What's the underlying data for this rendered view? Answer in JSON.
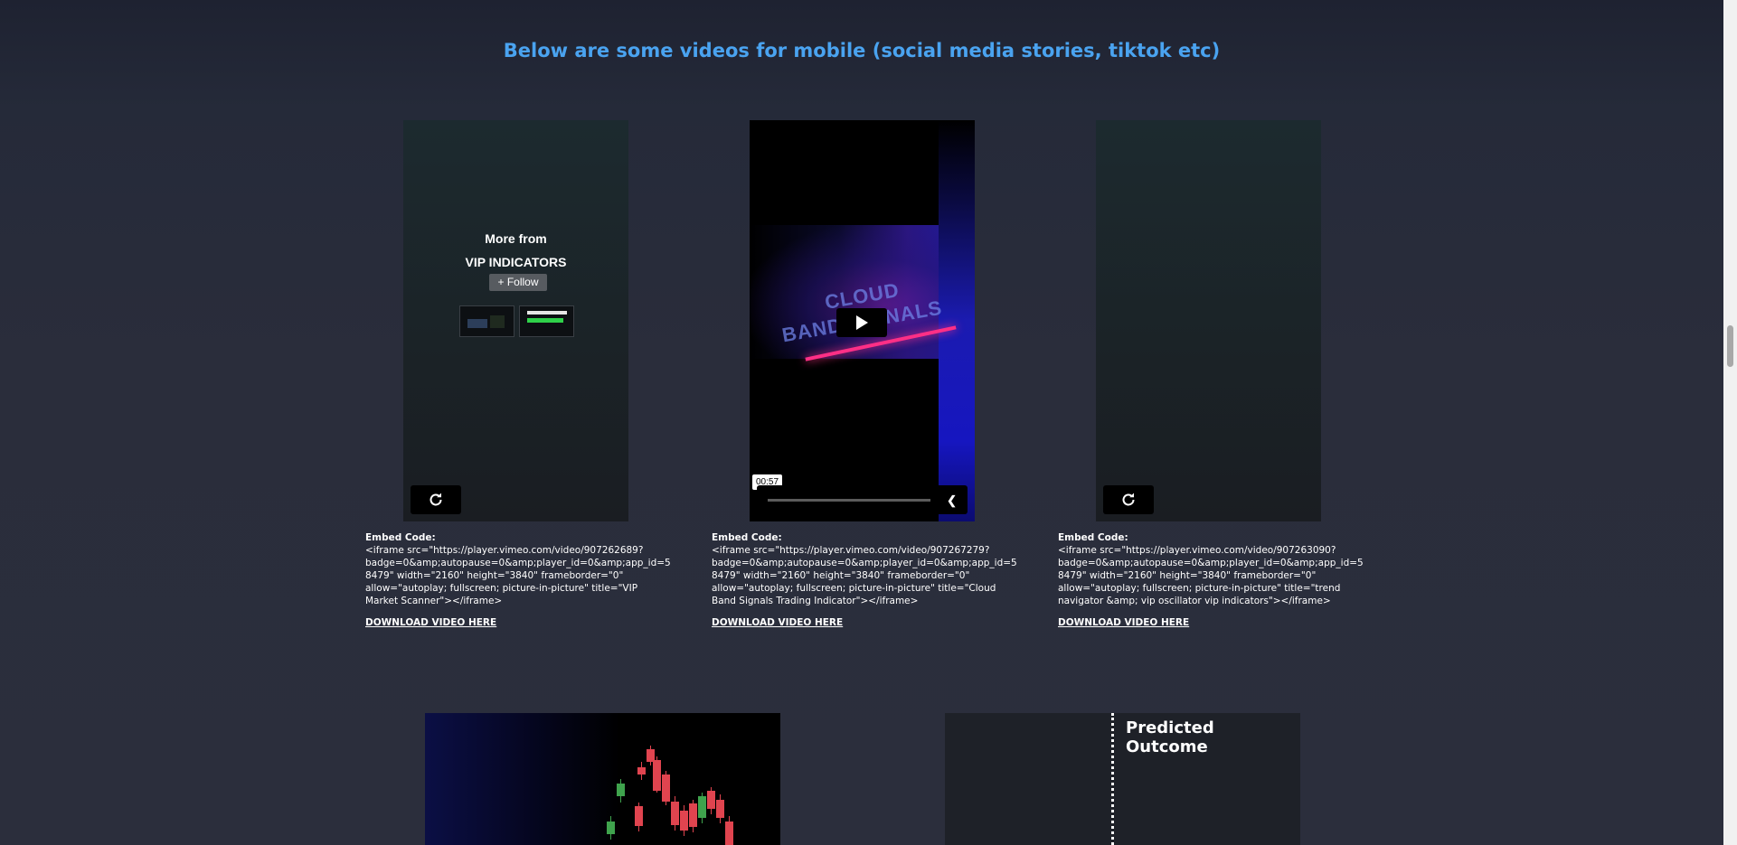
{
  "heading": "Below are some videos for mobile (social media stories, tiktok etc)",
  "videos": [
    {
      "end_screen": {
        "more_from": "More from",
        "channel": "VIP INDICATORS",
        "follow_label": "+ Follow"
      },
      "embed_label": "Embed Code:",
      "embed_code": "<iframe  src=\"https://player.vimeo.com/video/907262689?badge=0&amp;autopause=0&amp;player_id=0&amp;app_id=58479\" width=\"2160\" height=\"3840\" frameborder=\"0\" allow=\"autoplay; fullscreen; picture-in-picture\" title=\"VIP Market Scanner\"></iframe>",
      "download_label": "DOWNLOAD VIDEO HERE"
    },
    {
      "art_text_top": "CLOUD",
      "art_text_bottom": "BAND SIGNALS",
      "duration": "00:57",
      "progress": 0,
      "embed_label": "Embed Code:",
      "embed_code": "<iframe src=\"https://player.vimeo.com/video/907267279?badge=0&amp;autopause=0&amp;player_id=0&amp;app_id=58479\" width=\"2160\" height=\"3840\" frameborder=\"0\" allow=\"autoplay; fullscreen; picture-in-picture\" title=\"Cloud Band Signals Trading Indicator\"></iframe>",
      "download_label": "DOWNLOAD VIDEO HERE"
    },
    {
      "embed_label": "Embed Code:",
      "embed_code": "<iframe src=\"https://player.vimeo.com/video/907263090?badge=0&amp;autopause=0&amp;player_id=0&amp;app_id=58479\" width=\"2160\" height=\"3840\" frameborder=\"0\" allow=\"autoplay; fullscreen; picture-in-picture\" title=\"trend navigator &amp; vip oscillator vip indicators\"></iframe>",
      "download_label": "DOWNLOAD VIDEO HERE"
    }
  ],
  "previews": {
    "second_title": "Predicted Outcome"
  },
  "colors": {
    "heading": "#4aa3f0",
    "candle_up": "#3fa34d",
    "candle_down": "#e0444f",
    "background": "#2a2d3b"
  },
  "icons": {
    "replay": "replay-icon",
    "play": "play-icon",
    "chevron": "chevron-left-icon"
  }
}
